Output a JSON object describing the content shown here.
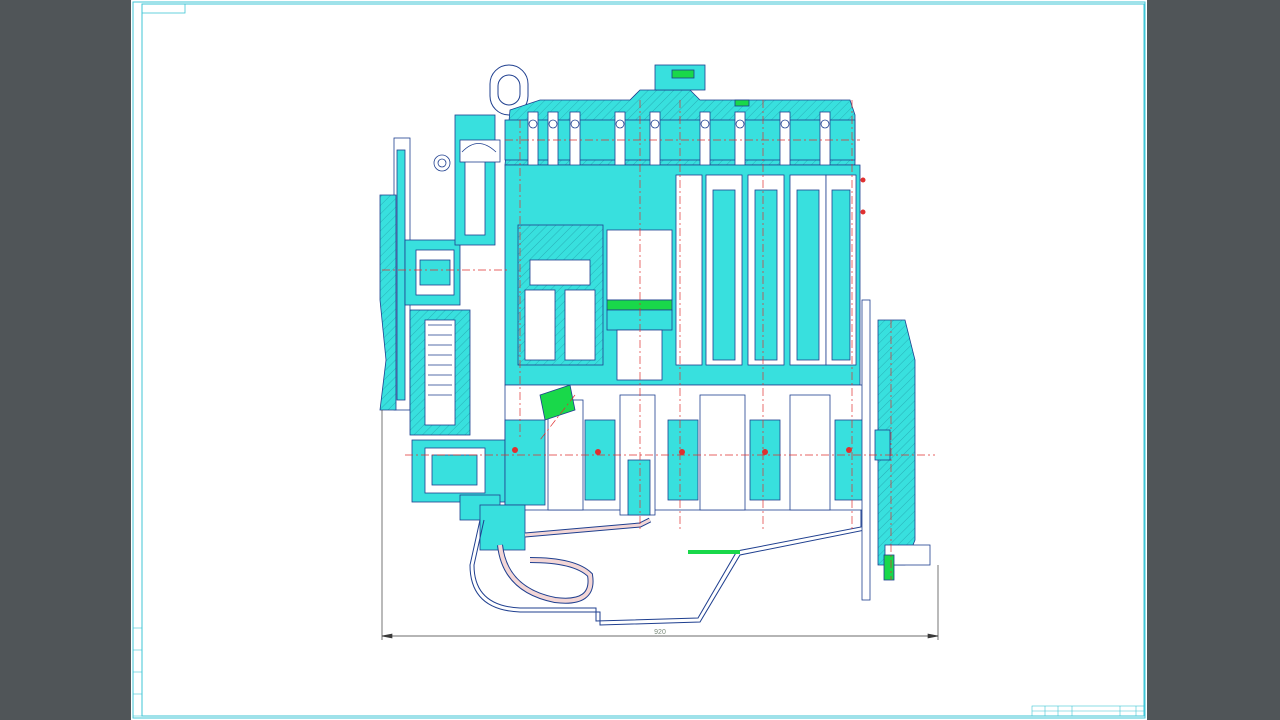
{
  "drawing": {
    "overall_length_dimension": "920",
    "colors": {
      "viewer_background": "#505558",
      "sheet": "#ffffff",
      "frame": "#3fc5d6",
      "section_fill": "#38e0de",
      "outline": "#1f3f8f",
      "centerline": "#e03030",
      "highlight": "#19d84a",
      "dimension": "#3a3a3a"
    }
  }
}
